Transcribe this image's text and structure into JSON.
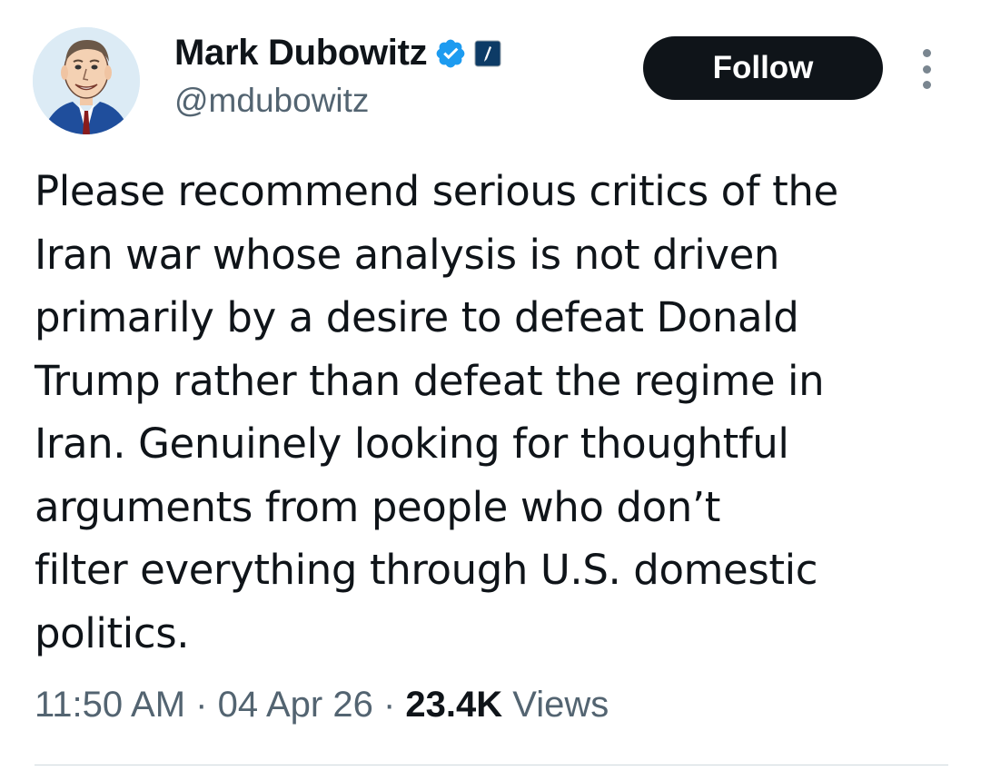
{
  "author": {
    "display_name": "Mark Dubowitz",
    "handle": "@mdubowitz",
    "avatar_icon": "caricature-avatar",
    "verified_badge_icon": "verified-badge-icon",
    "affiliation_badge_icon": "affiliation-badge-icon",
    "verified_color": "#1d9bf0",
    "affiliation_color": "#0d3b66"
  },
  "actions": {
    "follow_label": "Follow",
    "more_icon": "more-options-icon"
  },
  "tweet": {
    "lines": [
      "Please recommend serious critics of the",
      "Iran war whose analysis is not driven",
      "primarily by a desire to defeat Donald",
      "Trump rather than defeat the regime in",
      "Iran. Genuinely looking for thoughtful",
      "arguments from people who don’t",
      "filter everything through U.S. domestic",
      "politics."
    ]
  },
  "meta": {
    "time": "11:50 AM",
    "separator": " · ",
    "date": "04 Apr 26",
    "views_count": "23.4K",
    "views_label": " Views"
  }
}
